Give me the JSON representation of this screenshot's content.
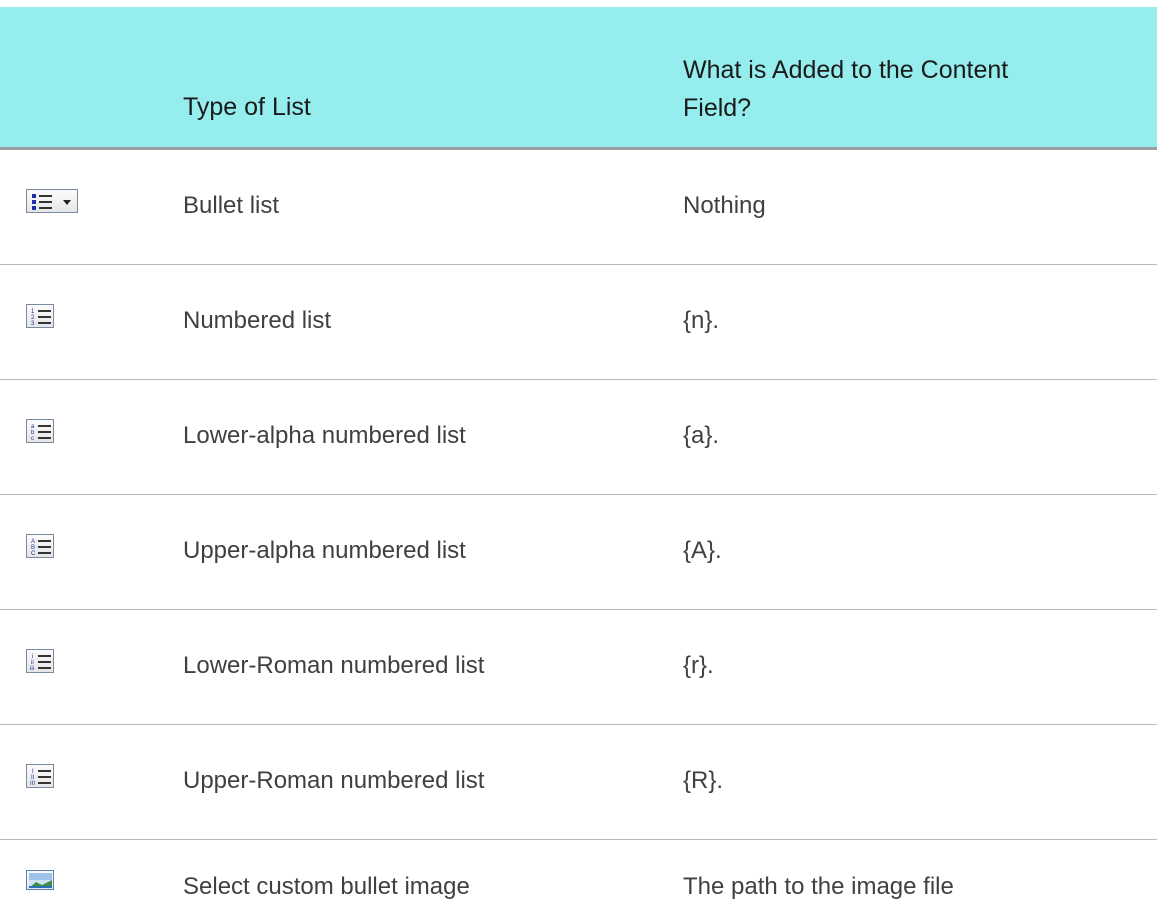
{
  "table": {
    "headers": {
      "type_of_list": "Type of List",
      "added_to_content_field": "What is Added to the Content Field?"
    },
    "rows": [
      {
        "icon": "bullet-list-dropdown-icon",
        "type": "Bullet list",
        "added": "Nothing"
      },
      {
        "icon": "numbered-list-icon",
        "type": "Numbered list",
        "added": "{n}."
      },
      {
        "icon": "lower-alpha-list-icon",
        "type": "Lower-alpha numbered list",
        "added": "{a}."
      },
      {
        "icon": "upper-alpha-list-icon",
        "type": "Upper-alpha numbered list",
        "added": "{A}."
      },
      {
        "icon": "lower-roman-list-icon",
        "type": "Lower-Roman numbered list",
        "added": "{r}."
      },
      {
        "icon": "upper-roman-list-icon",
        "type": "Upper-Roman numbered list",
        "added": "{R}."
      },
      {
        "icon": "custom-bullet-image-icon",
        "type": "Select custom bullet image",
        "added": "The path to the image file"
      }
    ]
  }
}
